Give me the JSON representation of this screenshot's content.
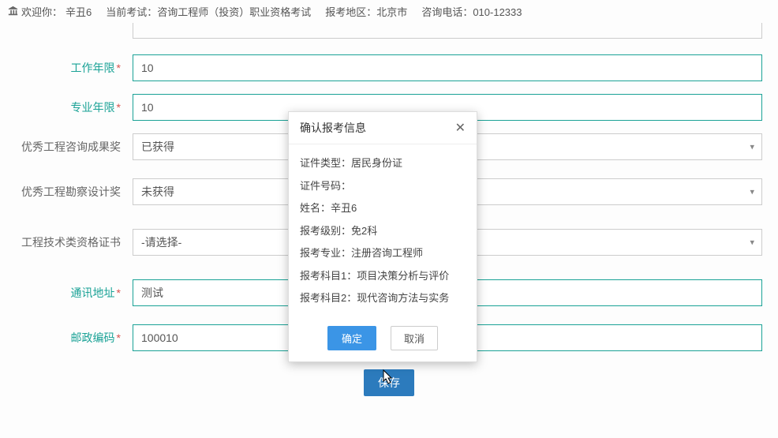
{
  "header": {
    "welcome_prefix": "欢迎你：",
    "username": "辛丑6",
    "current_exam_label": "当前考试：",
    "current_exam_value": "咨询工程师（投资）职业资格考试",
    "region_label": "报考地区：",
    "region_value": "北京市",
    "phone_label": "咨询电话：",
    "phone_value": "010-12333"
  },
  "form": {
    "work_years": {
      "label": "工作年限",
      "value": "10"
    },
    "prof_years": {
      "label": "专业年限",
      "value": "10"
    },
    "award1": {
      "label": "优秀工程咨询成果奖",
      "value": "已获得"
    },
    "award2": {
      "label": "优秀工程勘察设计奖",
      "value": "未获得"
    },
    "cert": {
      "label": "工程技术类资格证书",
      "value": "-请选择-"
    },
    "address": {
      "label": "通讯地址",
      "value": "测试"
    },
    "postcode": {
      "label": "邮政编码",
      "value": "100010"
    },
    "save_label": "保存"
  },
  "modal": {
    "title": "确认报考信息",
    "fields": {
      "id_type": {
        "label": "证件类型：",
        "value": "居民身份证"
      },
      "id_no": {
        "label": "证件号码：",
        "value": ""
      },
      "name": {
        "label": "姓名：",
        "value": "辛丑6"
      },
      "level": {
        "label": "报考级别：",
        "value": "免2科"
      },
      "major": {
        "label": "报考专业：",
        "value": "注册咨询工程师"
      },
      "subj1": {
        "label": "报考科目1：",
        "value": "项目决策分析与评价"
      },
      "subj2": {
        "label": "报考科目2：",
        "value": "现代咨询方法与实务"
      }
    },
    "confirm_label": "确定",
    "cancel_label": "取消"
  }
}
